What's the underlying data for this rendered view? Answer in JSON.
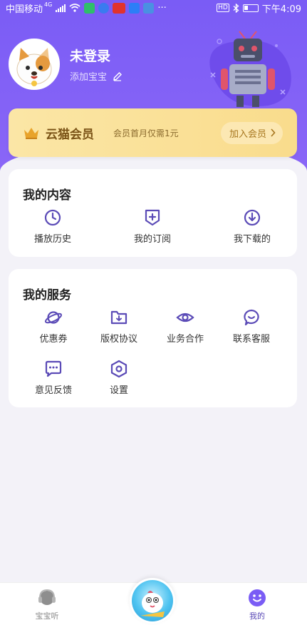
{
  "status_bar": {
    "carrier": "中国移动",
    "network": "4G",
    "time": "下午4:09",
    "hd_badge": "HD",
    "battery_icon": "battery-icon",
    "bluetooth_icon": "bluetooth-icon",
    "more": "···"
  },
  "profile": {
    "username": "未登录",
    "add_baby": "添加宝宝",
    "edit_icon": "pencil-icon"
  },
  "vip": {
    "crown_icon": "crown-icon",
    "title": "云猫会员",
    "description": "会员首月仅需1元",
    "join_button": "加入会员"
  },
  "my_content": {
    "title": "我的内容",
    "items": [
      {
        "label": "播放历史",
        "icon": "clock-icon"
      },
      {
        "label": "我的订阅",
        "icon": "subscribe-icon"
      },
      {
        "label": "我下载的",
        "icon": "download-icon"
      }
    ]
  },
  "my_services": {
    "title": "我的服务",
    "items": [
      {
        "label": "优惠券",
        "icon": "planet-icon"
      },
      {
        "label": "版权协议",
        "icon": "folder-download-icon"
      },
      {
        "label": "业务合作",
        "icon": "eye-icon"
      },
      {
        "label": "联系客服",
        "icon": "customer-service-icon"
      },
      {
        "label": "意见反馈",
        "icon": "chat-bubble-icon"
      },
      {
        "label": "设置",
        "icon": "settings-icon"
      }
    ]
  },
  "bottom_nav": {
    "items": [
      {
        "label": "宝宝听",
        "icon": "headphones-icon",
        "active": false
      },
      {
        "label": "我的",
        "icon": "smile-icon",
        "active": true
      }
    ],
    "center_icon": "play-mascot-icon"
  },
  "colors": {
    "primary": "#7a5cf5",
    "icon": "#5b4bb7",
    "vip_gold": "#7b5417",
    "nav_inactive": "#888888"
  }
}
